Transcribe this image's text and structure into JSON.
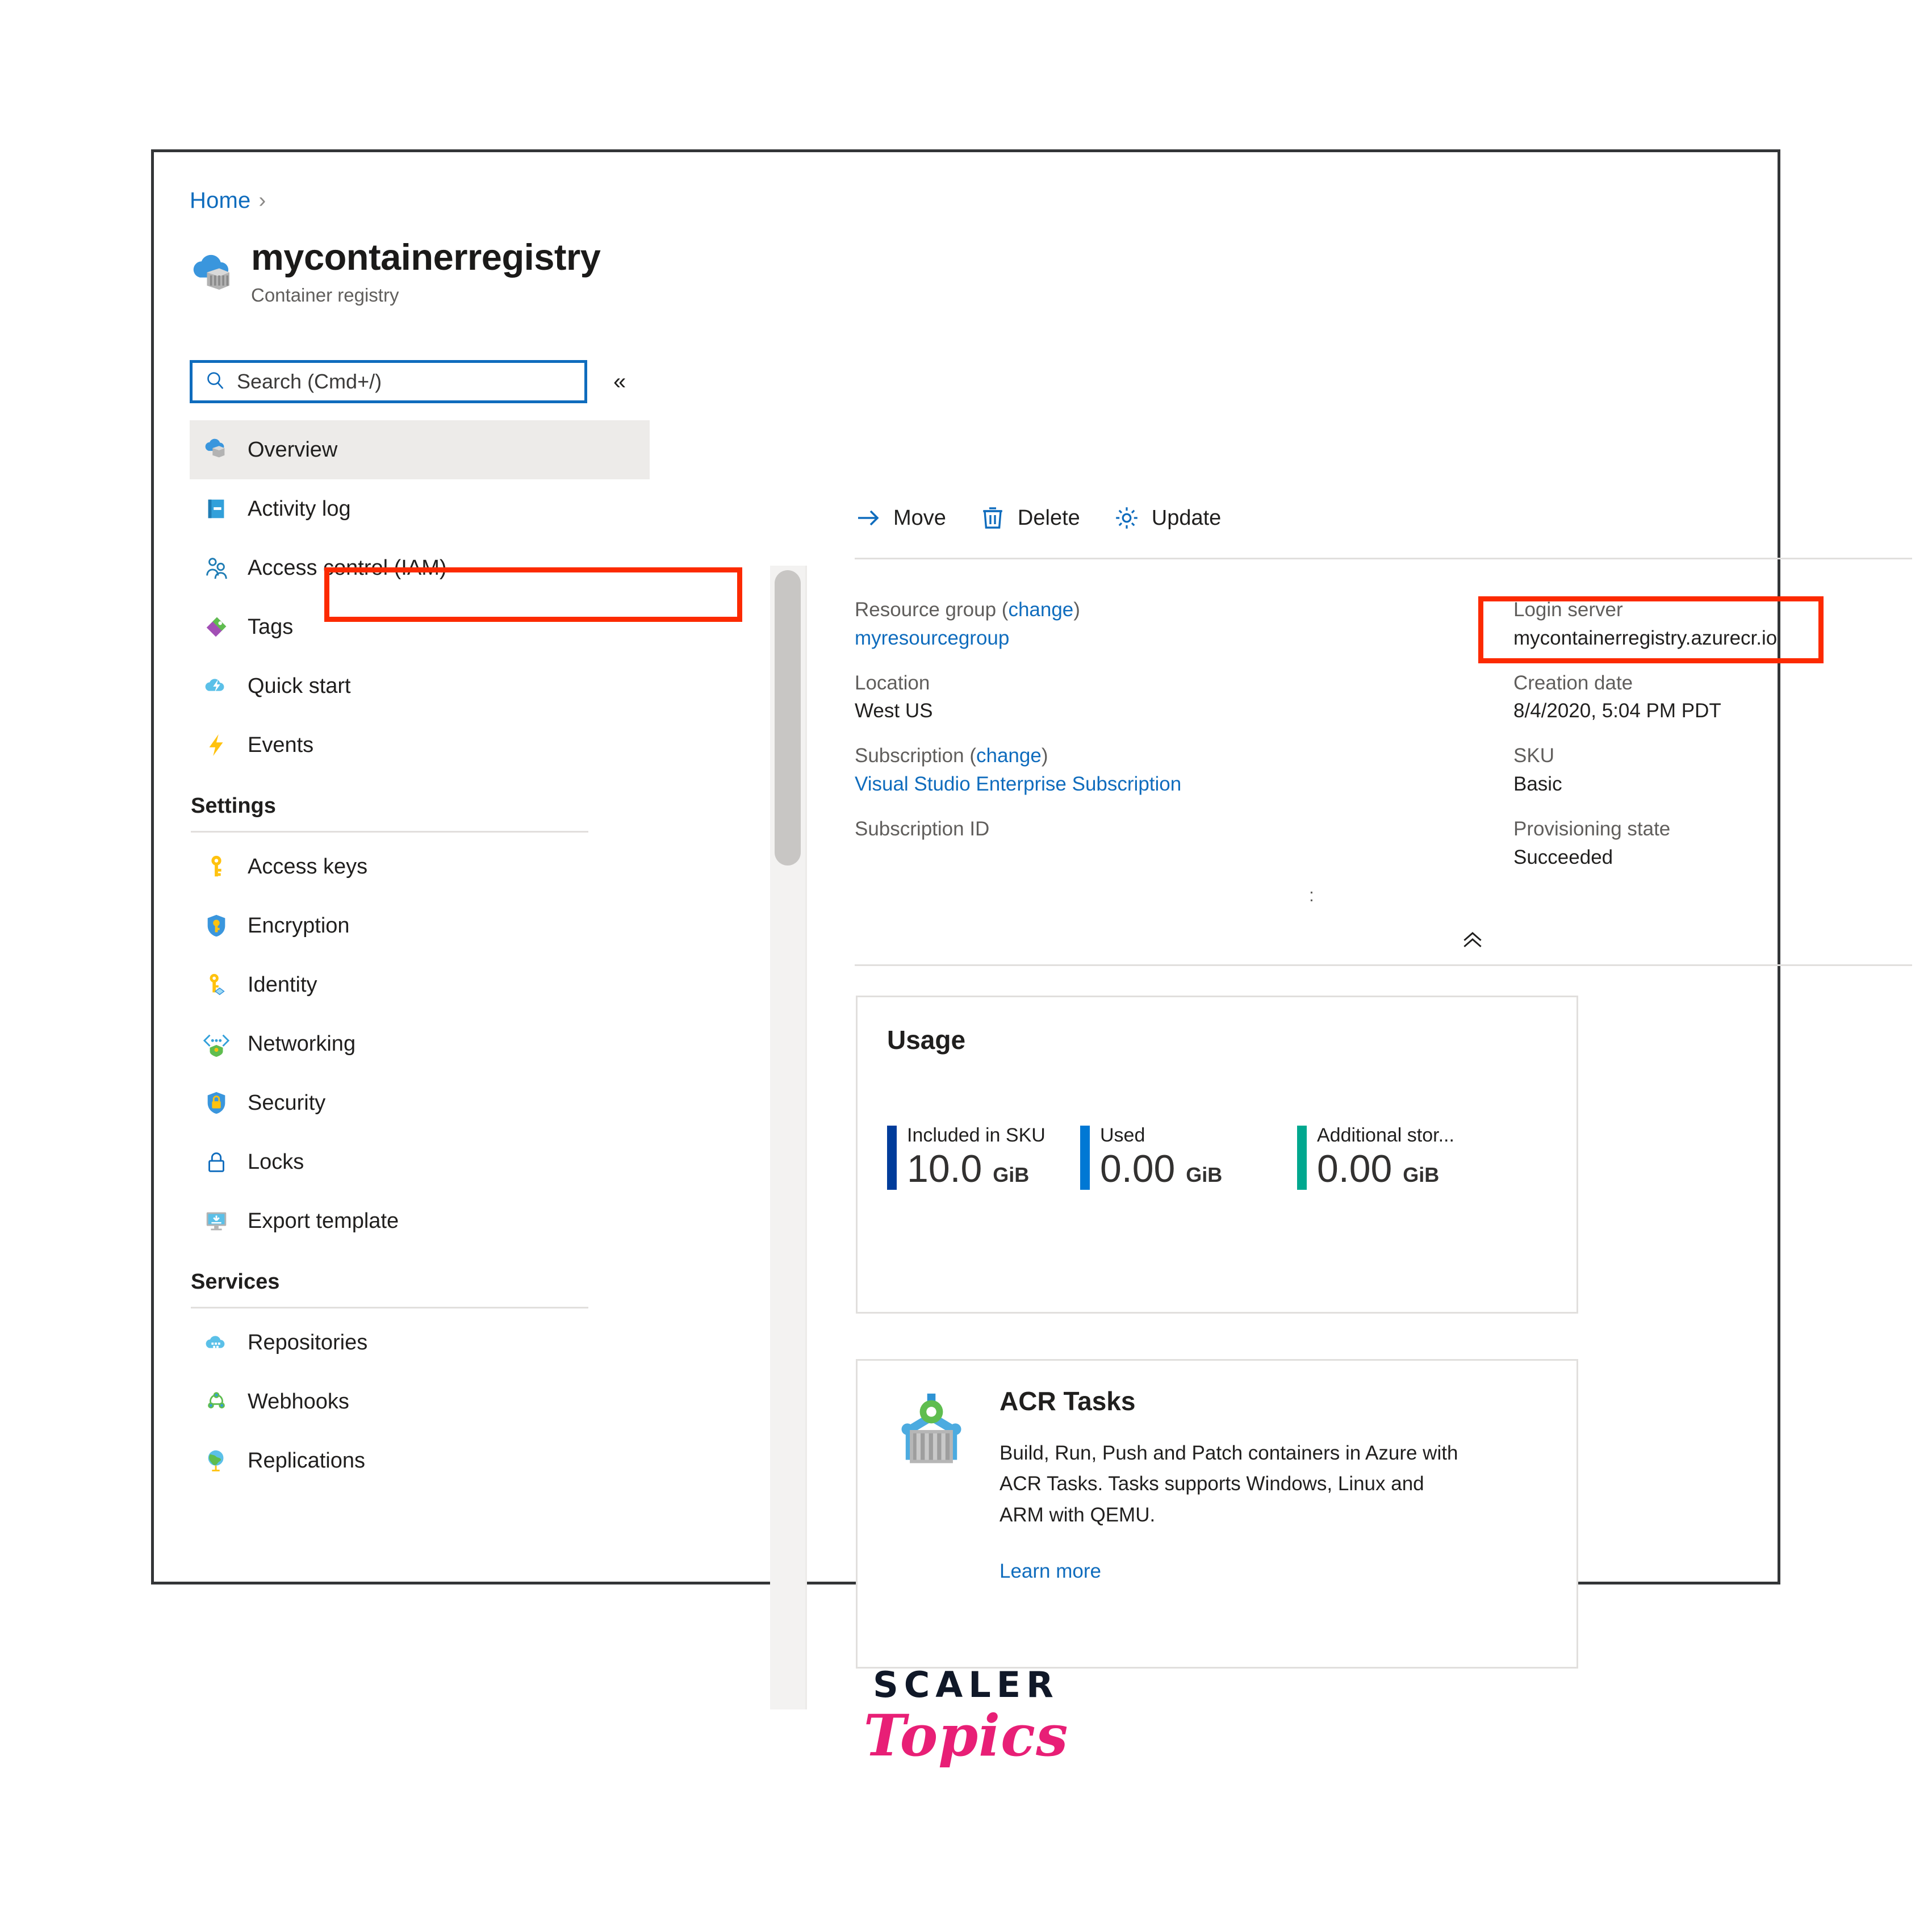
{
  "breadcrumb": {
    "home": "Home",
    "separator": "›"
  },
  "header": {
    "title": "mycontainerregistry",
    "subtitle": "Container registry",
    "icon": "container-registry-icon"
  },
  "search": {
    "placeholder": "Search (Cmd+/)",
    "value": "",
    "icon": "search-icon"
  },
  "collapse_nav": {
    "glyph": "«"
  },
  "sidebar": {
    "items": [
      {
        "label": "Overview",
        "icon": "container-registry-icon",
        "selected": true
      },
      {
        "label": "Activity log",
        "icon": "activity-log-icon",
        "selected": false
      },
      {
        "label": "Access control (IAM)",
        "icon": "access-control-icon",
        "selected": false
      },
      {
        "label": "Tags",
        "icon": "tags-icon",
        "selected": false
      },
      {
        "label": "Quick start",
        "icon": "quick-start-icon",
        "selected": false
      },
      {
        "label": "Events",
        "icon": "events-icon",
        "selected": false
      }
    ],
    "groups": [
      {
        "title": "Settings",
        "items": [
          {
            "label": "Access keys",
            "icon": "key-icon"
          },
          {
            "label": "Encryption",
            "icon": "encryption-shield-icon"
          },
          {
            "label": "Identity",
            "icon": "identity-key-icon"
          },
          {
            "label": "Networking",
            "icon": "networking-icon"
          },
          {
            "label": "Security",
            "icon": "security-shield-icon"
          },
          {
            "label": "Locks",
            "icon": "lock-icon"
          },
          {
            "label": "Export template",
            "icon": "export-template-icon"
          }
        ]
      },
      {
        "title": "Services",
        "items": [
          {
            "label": "Repositories",
            "icon": "repositories-icon"
          },
          {
            "label": "Webhooks",
            "icon": "webhooks-icon"
          },
          {
            "label": "Replications",
            "icon": "replications-globe-icon"
          }
        ]
      }
    ]
  },
  "toolbar": {
    "move": {
      "label": "Move",
      "icon": "arrow-right-icon"
    },
    "delete": {
      "label": "Delete",
      "icon": "trash-icon"
    },
    "update": {
      "label": "Update",
      "icon": "gear-icon"
    }
  },
  "essentials": {
    "left": [
      {
        "label": "Resource group",
        "label_link": "change",
        "value": "myresourcegroup",
        "value_is_link": true
      },
      {
        "label": "Location",
        "value": "West US",
        "value_is_link": false
      },
      {
        "label": "Subscription",
        "label_link": "change",
        "value": "Visual Studio Enterprise Subscription",
        "value_is_link": true
      },
      {
        "label": "Subscription ID",
        "value": "",
        "value_is_link": false
      }
    ],
    "right": [
      {
        "label": "Login server",
        "value": "mycontainerregistry.azurecr.io",
        "highlighted": true
      },
      {
        "label": "Creation date",
        "value": "8/4/2020, 5:04 PM PDT"
      },
      {
        "label": "SKU",
        "value": "Basic"
      },
      {
        "label": "Provisioning state",
        "value": "Succeeded"
      }
    ],
    "subscription_id_mask": ":",
    "collapse_glyph": "«"
  },
  "usage": {
    "title": "Usage",
    "metrics": [
      {
        "label": "Included in SKU",
        "value": "10.0",
        "unit": "GiB",
        "color": "#003C9B"
      },
      {
        "label": "Used",
        "value": "0.00",
        "unit": "GiB",
        "color": "#0078D4"
      },
      {
        "label": "Additional stor...",
        "value": "0.00",
        "unit": "GiB",
        "color": "#00A88F"
      }
    ]
  },
  "acr_tasks": {
    "icon": "acr-tasks-crane-icon",
    "title": "ACR Tasks",
    "description": "Build, Run, Push and Patch containers in Azure with ACR Tasks. Tasks supports Windows, Linux and ARM with QEMU.",
    "link": "Learn more"
  },
  "watermark": {
    "line1": "SCALER",
    "line2": "Topics",
    "color": "#e81f76"
  },
  "annotation_color": "#fc2a00"
}
